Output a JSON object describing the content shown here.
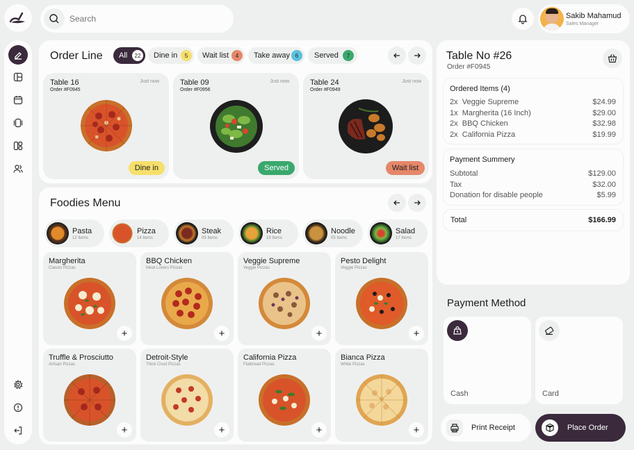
{
  "search": {
    "placeholder": "Search"
  },
  "user": {
    "name": "Sakib Mahamud",
    "role": "Sales Manager"
  },
  "order_line": {
    "title": "Order Line",
    "filters": [
      {
        "label": "All",
        "count": "22",
        "color": "#ffffff"
      },
      {
        "label": "Dine in",
        "count": "5",
        "color": "#f6df6b"
      },
      {
        "label": "Wait list",
        "count": "4",
        "color": "#e5876a"
      },
      {
        "label": "Take away",
        "count": "6",
        "color": "#5bc0de"
      },
      {
        "label": "Served",
        "count": "7",
        "color": "#3aa86d"
      }
    ],
    "orders": [
      {
        "table": "Table 16",
        "order": "Order #F0945",
        "time": "Just now",
        "status": "Dine in"
      },
      {
        "table": "Table 09",
        "order": "Order #F0956",
        "time": "Just now",
        "status": "Served"
      },
      {
        "table": "Table 24",
        "order": "Order #F0949",
        "time": "Just now",
        "status": "Wait list"
      }
    ]
  },
  "menu": {
    "title": "Foodies Menu",
    "categories": [
      {
        "name": "Pasta",
        "count": "12 Items"
      },
      {
        "name": "Pizza",
        "count": "14 Items"
      },
      {
        "name": "Steak",
        "count": "09 Items"
      },
      {
        "name": "Rice",
        "count": "19 Items"
      },
      {
        "name": "Noodle",
        "count": "05 Items"
      },
      {
        "name": "Salad",
        "count": "17 Items"
      }
    ],
    "items": [
      {
        "name": "Margherita",
        "sub": "Classic Pizzas"
      },
      {
        "name": "BBQ Chicken",
        "sub": "Meat Lovers Pizzas"
      },
      {
        "name": "Veggie Supreme",
        "sub": "Veggie Pizzas"
      },
      {
        "name": "Pesto Delight",
        "sub": "Veggie Pizzas"
      },
      {
        "name": "Truffle & Prosciutto",
        "sub": "Artisan Pizzas"
      },
      {
        "name": "Detroit-Style",
        "sub": "Thick Crust Pizzas"
      },
      {
        "name": "California Pizza",
        "sub": "Flatbread Pizzas"
      },
      {
        "name": "Bianca Pizza",
        "sub": "White Pizzas"
      }
    ]
  },
  "table": {
    "title": "Table No #26",
    "order": "Order #F0945",
    "ordered_title": "Ordered Items (4)",
    "items": [
      {
        "qty": "2x",
        "name": "Veggie Supreme",
        "price": "$24.99"
      },
      {
        "qty": "1x",
        "name": "Margherita (16 Inch)",
        "price": "$29.00"
      },
      {
        "qty": "2x",
        "name": "BBQ Chicken",
        "price": "$32.98"
      },
      {
        "qty": "2x",
        "name": "California Pizza",
        "price": "$19.99"
      }
    ],
    "payment_title": "Payment Summery",
    "payment_lines": [
      {
        "label": "Subtotal",
        "value": "$129.00"
      },
      {
        "label": "Tax",
        "value": "$32.00"
      },
      {
        "label": "Donation for disable people",
        "value": "$5.99"
      }
    ],
    "total_label": "Total",
    "total_value": "$166.99"
  },
  "payment_method": {
    "title": "Payment Method",
    "cash": "Cash",
    "card": "Card"
  },
  "actions": {
    "print": "Print Receipt",
    "place": "Place Order"
  },
  "colors": {
    "primary": "#3a2a3c",
    "yellow": "#f6df6b",
    "green": "#3aa86d",
    "orange": "#e5876a",
    "blue": "#5bc0de"
  }
}
